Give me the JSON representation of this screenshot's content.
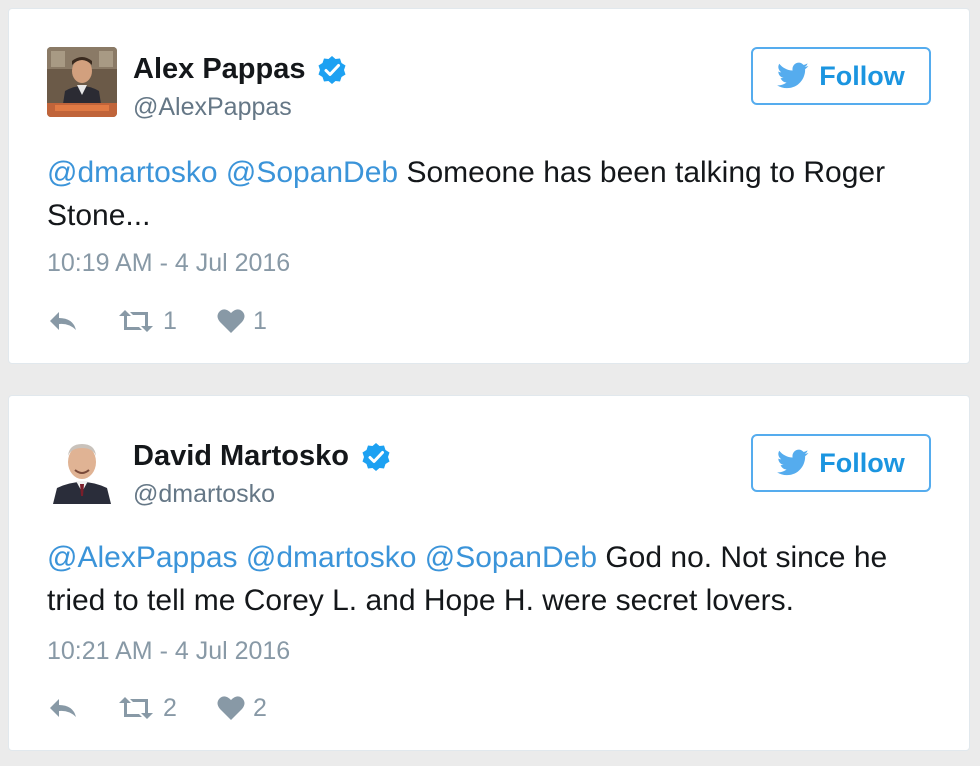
{
  "tweets": [
    {
      "display_name": "Alex Pappas",
      "handle": "@AlexPappas",
      "follow_label": "Follow",
      "text_segments": [
        {
          "type": "mention",
          "text": "@dmartosko"
        },
        {
          "type": "text",
          "text": " "
        },
        {
          "type": "mention",
          "text": "@SopanDeb"
        },
        {
          "type": "text",
          "text": " Someone has been talking to Roger Stone..."
        }
      ],
      "timestamp": "10:19 AM - 4 Jul 2016",
      "retweets": "1",
      "likes": "1"
    },
    {
      "display_name": "David Martosko",
      "handle": "@dmartosko",
      "follow_label": "Follow",
      "text_segments": [
        {
          "type": "mention",
          "text": "@AlexPappas"
        },
        {
          "type": "text",
          "text": " "
        },
        {
          "type": "mention",
          "text": "@dmartosko"
        },
        {
          "type": "text",
          "text": " "
        },
        {
          "type": "mention",
          "text": "@SopanDeb"
        },
        {
          "type": "text",
          "text": " God no. Not since he tried to tell me Corey L. and Hope H. were secret lovers."
        }
      ],
      "timestamp": "10:21 AM - 4 Jul 2016",
      "retweets": "2",
      "likes": "2"
    }
  ],
  "icons": {
    "verified": "verified-badge-icon",
    "follow": "twitter-bird-icon",
    "reply": "reply-icon",
    "retweet": "retweet-icon",
    "like": "heart-icon"
  },
  "colors": {
    "link": "#3b94d9",
    "verified": "#1da1f2",
    "muted": "#8899a6",
    "follow_border": "#55acee"
  }
}
